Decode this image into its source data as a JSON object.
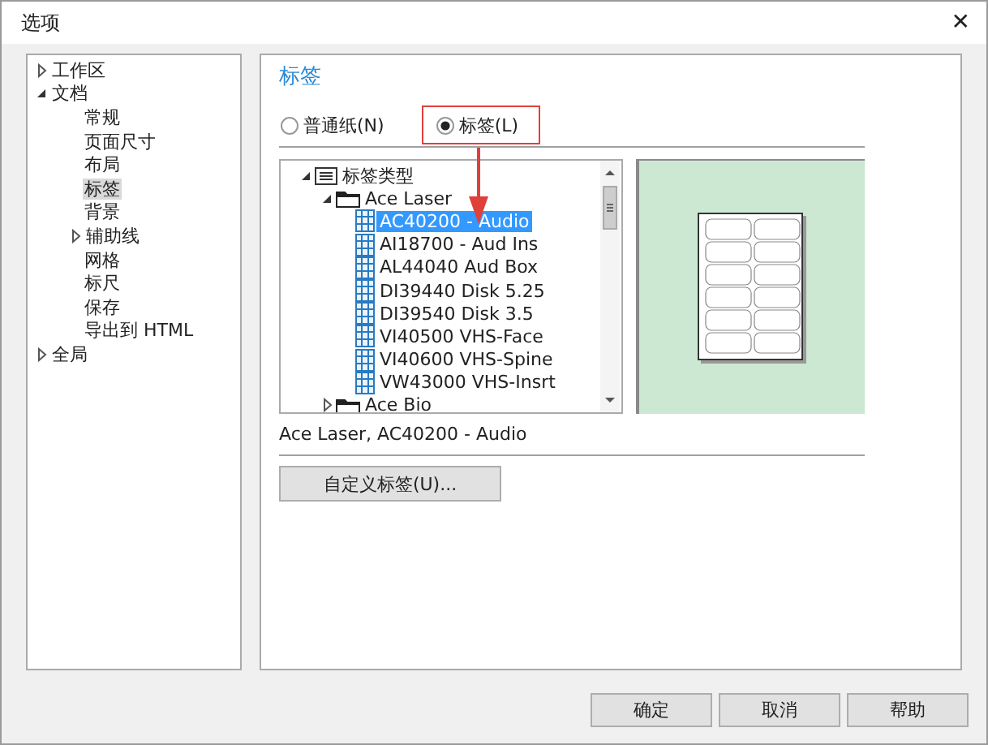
{
  "window": {
    "title": "选项",
    "close": "✕"
  },
  "nav_tree": [
    {
      "label": "工作区",
      "expanded": false,
      "selected": false
    },
    {
      "label": "文档",
      "expanded": true,
      "selected": false,
      "children": [
        {
          "label": "常规",
          "selected": false
        },
        {
          "label": "页面尺寸",
          "selected": false
        },
        {
          "label": "布局",
          "selected": false
        },
        {
          "label": "标签",
          "selected": true
        },
        {
          "label": "背景",
          "selected": false
        },
        {
          "label": "辅助线",
          "selected": false,
          "expanded": false
        },
        {
          "label": "网格",
          "selected": false
        },
        {
          "label": "标尺",
          "selected": false
        },
        {
          "label": "保存",
          "selected": false
        },
        {
          "label": "导出到 HTML",
          "selected": false
        }
      ]
    },
    {
      "label": "全局",
      "expanded": false,
      "selected": false
    }
  ],
  "panel": {
    "title": "标签",
    "radios": [
      {
        "label": "普通纸(N)",
        "selected": false,
        "highlighted": false
      },
      {
        "label": "标签(L)",
        "selected": true,
        "highlighted": true
      }
    ],
    "label_tree": [
      {
        "label": "标签类型",
        "kind": "category",
        "expanded": true,
        "selected": false,
        "children": [
          {
            "label": "Ace Laser",
            "kind": "folder",
            "expanded": true,
            "selected": false,
            "children": [
              {
                "label": "AC40200 - Audio",
                "kind": "label",
                "selected": true
              },
              {
                "label": "AI18700 - Aud Ins",
                "kind": "label",
                "selected": false
              },
              {
                "label": "AL44040 Aud Box",
                "kind": "label",
                "selected": false
              },
              {
                "label": "DI39440 Disk 5.25",
                "kind": "label",
                "selected": false
              },
              {
                "label": "DI39540 Disk 3.5",
                "kind": "label",
                "selected": false
              },
              {
                "label": "VI40500 VHS-Face",
                "kind": "label",
                "selected": false
              },
              {
                "label": "VI40600 VHS-Spine",
                "kind": "label",
                "selected": false
              },
              {
                "label": "VW43000 VHS-Insrt",
                "kind": "label",
                "selected": false
              }
            ]
          },
          {
            "label": "Ace Bio",
            "kind": "folder",
            "expanded": false,
            "selected": false
          }
        ]
      }
    ],
    "status": "Ace Laser, AC40200 - Audio",
    "custom_button": "自定义标签(U)..."
  },
  "buttons": [
    "确定",
    "取消",
    "帮助"
  ]
}
